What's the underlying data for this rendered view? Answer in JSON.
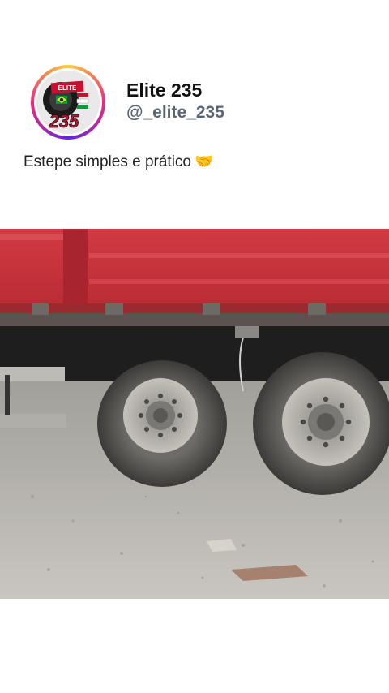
{
  "post": {
    "display_name": "Elite 235",
    "handle": "@_elite_235",
    "caption": "Estepe simples e prático",
    "caption_emoji": "🤝"
  },
  "avatar": {
    "logo_text": "235",
    "banner_text": "ELITE"
  },
  "media": {
    "description_icon": "video-frame"
  },
  "colors": {
    "handle": "#5b6675",
    "ring_start": "#f9ce34",
    "ring_mid": "#ee2a7b",
    "ring_end": "#6228d7",
    "truck_red": "#c8323a"
  }
}
